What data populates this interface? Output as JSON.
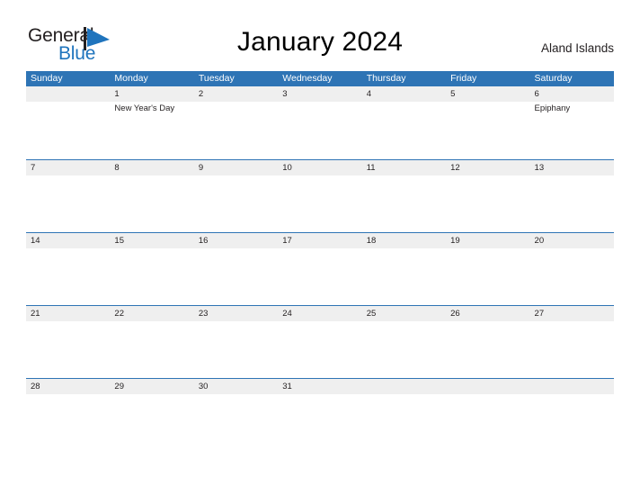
{
  "brand": {
    "name_line1": "General",
    "name_line2": "Blue",
    "logo_icon": "triangle-flag-icon",
    "color_dark": "#231f20",
    "color_blue": "#1f74bd"
  },
  "header": {
    "title": "January 2024",
    "location": "Aland Islands"
  },
  "theme": {
    "header_blue": "#2e74b5",
    "band_gray": "#efefef",
    "text_dark": "#231f20",
    "page_background": "#ffffff"
  },
  "calendar": {
    "weekdays": [
      "Sunday",
      "Monday",
      "Tuesday",
      "Wednesday",
      "Thursday",
      "Friday",
      "Saturday"
    ],
    "weeks": [
      {
        "days": [
          {
            "date": "",
            "event": ""
          },
          {
            "date": "1",
            "event": "New Year's Day"
          },
          {
            "date": "2",
            "event": ""
          },
          {
            "date": "3",
            "event": ""
          },
          {
            "date": "4",
            "event": ""
          },
          {
            "date": "5",
            "event": ""
          },
          {
            "date": "6",
            "event": "Epiphany"
          }
        ]
      },
      {
        "days": [
          {
            "date": "7",
            "event": ""
          },
          {
            "date": "8",
            "event": ""
          },
          {
            "date": "9",
            "event": ""
          },
          {
            "date": "10",
            "event": ""
          },
          {
            "date": "11",
            "event": ""
          },
          {
            "date": "12",
            "event": ""
          },
          {
            "date": "13",
            "event": ""
          }
        ]
      },
      {
        "days": [
          {
            "date": "14",
            "event": ""
          },
          {
            "date": "15",
            "event": ""
          },
          {
            "date": "16",
            "event": ""
          },
          {
            "date": "17",
            "event": ""
          },
          {
            "date": "18",
            "event": ""
          },
          {
            "date": "19",
            "event": ""
          },
          {
            "date": "20",
            "event": ""
          }
        ]
      },
      {
        "days": [
          {
            "date": "21",
            "event": ""
          },
          {
            "date": "22",
            "event": ""
          },
          {
            "date": "23",
            "event": ""
          },
          {
            "date": "24",
            "event": ""
          },
          {
            "date": "25",
            "event": ""
          },
          {
            "date": "26",
            "event": ""
          },
          {
            "date": "27",
            "event": ""
          }
        ]
      },
      {
        "days": [
          {
            "date": "28",
            "event": ""
          },
          {
            "date": "29",
            "event": ""
          },
          {
            "date": "30",
            "event": ""
          },
          {
            "date": "31",
            "event": ""
          },
          {
            "date": "",
            "event": ""
          },
          {
            "date": "",
            "event": ""
          },
          {
            "date": "",
            "event": ""
          }
        ]
      }
    ]
  }
}
